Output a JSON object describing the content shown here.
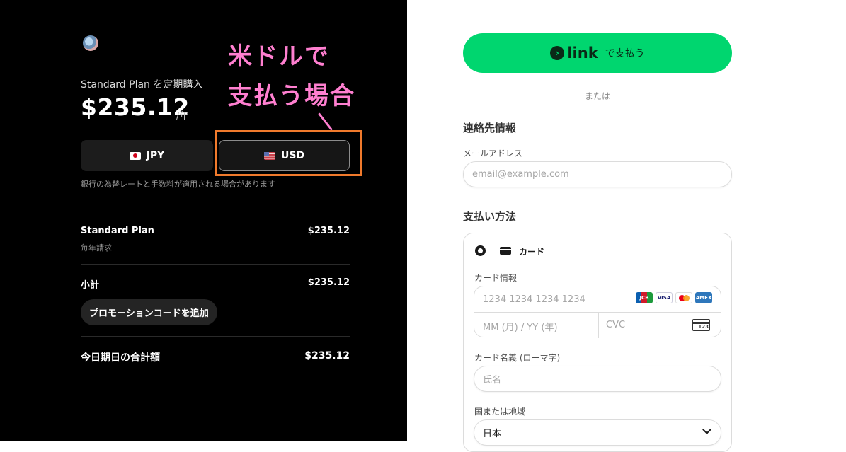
{
  "summary": {
    "plan_title": "Standard Plan を定期購入",
    "price": "$235.12",
    "price_unit": "/年",
    "currency_options": [
      {
        "code": "JPY",
        "flag": "jp-flag-icon"
      },
      {
        "code": "USD",
        "flag": "us-flag-icon",
        "selected": true
      }
    ],
    "fx_note": "銀行の為替レートと手数料が適用される場合があります",
    "line_item": {
      "name": "Standard Plan",
      "price": "$235.12",
      "billing": "毎年請求"
    },
    "subtotal": {
      "label": "小計",
      "value": "$235.12"
    },
    "promo_button": "プロモーションコードを追加",
    "total": {
      "label": "今日期日の合計額",
      "value": "$235.12"
    }
  },
  "annotation": {
    "line1": "米ドルで",
    "line2": "支払う場合",
    "color": "#ff7fd0",
    "box_color": "#f07a2c"
  },
  "checkout": {
    "link_button": {
      "word": "link",
      "suffix": "で支払う",
      "color": "#00d66f"
    },
    "or_text": "または",
    "contact_title": "連絡先情報",
    "email_label": "メールアドレス",
    "email_placeholder": "email@example.com",
    "payment_title": "支払い方法",
    "card_option": "カード",
    "card_info_label": "カード情報",
    "card_number_placeholder": "1234 1234 1234 1234",
    "expiry_placeholder": "MM (月) / YY (年)",
    "cvc_placeholder": "CVC",
    "card_brands": [
      "JCB",
      "VISA",
      "",
      "AMEX"
    ],
    "cvc_icon_text": "123",
    "cardholder_label": "カード名義 (ローマ字)",
    "cardholder_placeholder": "氏名",
    "country_label": "国または地域",
    "country_value": "日本"
  }
}
